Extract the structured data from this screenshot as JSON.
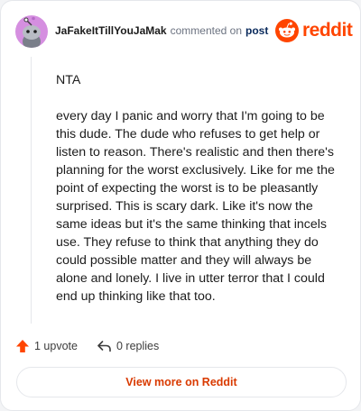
{
  "header": {
    "username": "JaFakeItTillYouJaMak",
    "action_text": "commented on",
    "post_link": "post",
    "logo_text": "reddit",
    "logo_icon": "reddit-snoo-icon",
    "avatar_icon": "snoo-avatar-icon"
  },
  "comment": {
    "paragraphs": [
      "NTA",
      "every day I panic and worry that I'm going to be this dude. The dude who refuses to get help or listen to reason. There's realistic and then there's planning for the worst exclusively. Like for me the point of expecting the worst is to be pleasantly surprised. This is scary dark. Like it's now the same ideas but it's the same thinking that incels use. They refuse to think that anything they do could possible matter and they will always be alone and lonely. I live in utter terror that I could end up thinking like that too."
    ]
  },
  "actions": {
    "upvote_label": "1 upvote",
    "upvote_icon": "upvote-arrow-icon",
    "replies_label": "0 replies",
    "replies_icon": "reply-arrow-icon"
  },
  "footer": {
    "view_button_label": "View more on Reddit"
  },
  "colors": {
    "brand": "#ff4500",
    "avatar_bg": "#d58fe0",
    "link": "#0a2a5c",
    "button_text": "#d93a00"
  }
}
